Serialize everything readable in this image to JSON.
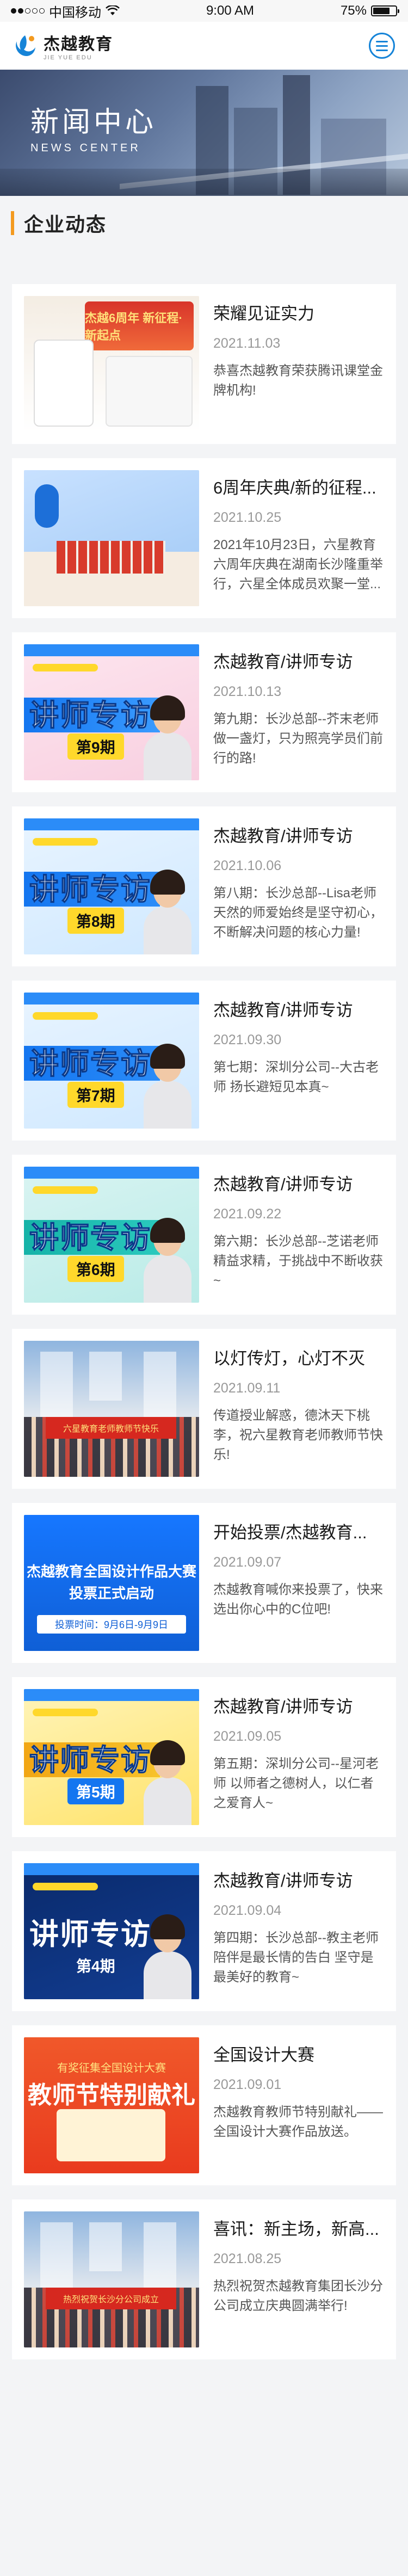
{
  "status_bar": {
    "carrier": "中国移动",
    "time": "9:00 AM",
    "battery": "75%",
    "battery_level": 0.75
  },
  "header": {
    "logo_cn": "杰越教育",
    "logo_en": "JIE YUE EDU",
    "menu_icon": "menu-icon"
  },
  "banner": {
    "title_cn": "新闻中心",
    "title_en": "NEWS CENTER"
  },
  "section": {
    "title": "企业动态"
  },
  "news": [
    {
      "title": "荣耀见证实力",
      "date": "2021.11.03",
      "summary": "恭喜杰越教育荣获腾讯课堂金牌机构!",
      "thumb": "honor",
      "thumb_text": "杰越6周年 新征程·新起点"
    },
    {
      "title": "6周年庆典/新的征程...",
      "date": "2021.10.25",
      "summary": "2021年10月23日，六星教育六周年庆典在湖南长沙隆重举行，六星全体成员欢聚一堂...",
      "thumb": "celebration",
      "thumb_text": ""
    },
    {
      "title": "杰越教育/讲师专访",
      "date": "2021.10.13",
      "summary": "第九期：长沙总部--芥末老师做一盏灯，只为照亮学员们前行的路!",
      "thumb": "pink",
      "thumb_text": "讲师专访",
      "issue": "第9期"
    },
    {
      "title": "杰越教育/讲师专访",
      "date": "2021.10.06",
      "summary": "第八期：长沙总部--Lisa老师天然的师爱始终是坚守初心，不断解决问题的核心力量!",
      "thumb": "interview",
      "thumb_text": "讲师专访",
      "issue": "第8期"
    },
    {
      "title": "杰越教育/讲师专访",
      "date": "2021.09.30",
      "summary": "第七期：深圳分公司--大古老师 扬长避短见本真~",
      "thumb": "yellow-light",
      "thumb_text": "讲师专访",
      "issue": "第7期"
    },
    {
      "title": "杰越教育/讲师专访",
      "date": "2021.09.22",
      "summary": "第六期：长沙总部--芝诺老师精益求精，于挑战中不断收获~",
      "thumb": "teal",
      "thumb_text": "讲师专访",
      "issue": "第6期"
    },
    {
      "title": "以灯传灯，心灯不灭",
      "date": "2021.09.11",
      "summary": "传道授业解惑，德沐天下桃李，祝六星教育老师教师节快乐!",
      "thumb": "photo",
      "thumb_text": "六星教育老师教师节快乐"
    },
    {
      "title": "开始投票/杰越教育...",
      "date": "2021.09.07",
      "summary": "杰越教育喊你来投票了，快来选出你心中的C位吧!",
      "thumb": "blue-poster",
      "thumb_text_1": "杰越教育全国设计作品大赛",
      "thumb_text_2": "投票正式启动",
      "thumb_date": "投票时间：9月6日-9月9日"
    },
    {
      "title": "杰越教育/讲师专访",
      "date": "2021.09.05",
      "summary": "第五期：深圳分公司--星河老师 以师者之德树人，以仁者之爱育人~",
      "thumb": "yellow",
      "thumb_text": "讲师专访",
      "issue": "第5期"
    },
    {
      "title": "杰越教育/讲师专访",
      "date": "2021.09.04",
      "summary": "第四期：长沙总部--教主老师陪伴是最长情的告白 坚守是最美好的教育~",
      "thumb": "navy",
      "thumb_text": "讲师专访",
      "issue": "第4期"
    },
    {
      "title": "全国设计大赛",
      "date": "2021.09.01",
      "summary": "杰越教育教师节特别献礼——全国设计大赛作品放送。",
      "thumb": "orange",
      "thumb_text_1": "有奖征集全国设计大赛",
      "thumb_text_2": "教师节特别献礼"
    },
    {
      "title": "喜讯：新主场，新高...",
      "date": "2021.08.25",
      "summary": "热烈祝贺杰越教育集团长沙分公司成立庆典圆满举行!",
      "thumb": "photo2",
      "thumb_text": "热烈祝贺长沙分公司成立"
    }
  ]
}
